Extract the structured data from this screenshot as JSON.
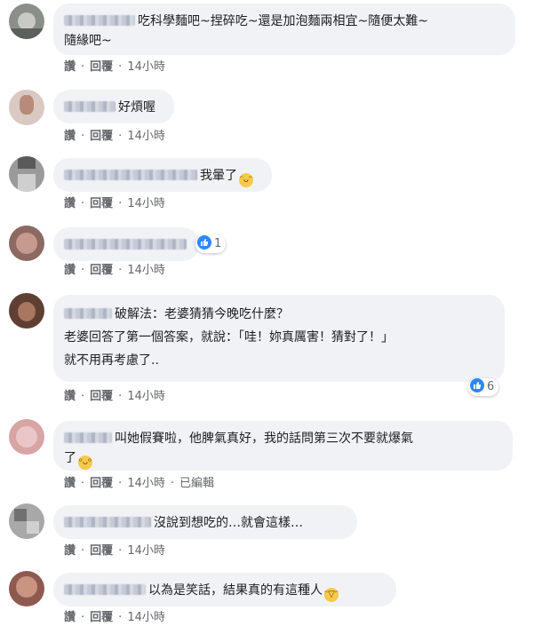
{
  "actions": {
    "like": "讚",
    "reply": "回覆",
    "time": "14小時",
    "edited": "已編輯"
  },
  "comments": [
    {
      "lines": [
        "吃科學麵吧~捏碎吃~還是加泡麵兩相宜~隨便太難~",
        "隨緣吧~"
      ]
    },
    {
      "lines": [
        "好煩喔"
      ]
    },
    {
      "lines": [
        "我暈了"
      ],
      "emoji": "grinning-sweat-emoji"
    },
    {
      "lines": [
        ""
      ],
      "reaction_count": "1"
    },
    {
      "lines": [
        "破解法：老婆猜猜今晚吃什麼？",
        "老婆回答了第一個答案，就說：「哇！妳真厲害！猜對了！」",
        "就不用再考慮了.."
      ],
      "reaction_count": "6"
    },
    {
      "lines": [
        "叫她假賽啦，他脾氣真好，我的話問第三次不要就爆氣",
        "了"
      ],
      "emoji": "rolling-eyes-emoji"
    },
    {
      "lines": [
        "沒說到想吃的…就會這樣…"
      ]
    },
    {
      "lines": [
        "以為是笑話，結果真的有這種人"
      ],
      "emoji": "rofl-emoji"
    }
  ],
  "colors": {
    "like_blue": "#2d88ff",
    "bubble": "#f0f2f5",
    "meta_text": "#65676b"
  }
}
